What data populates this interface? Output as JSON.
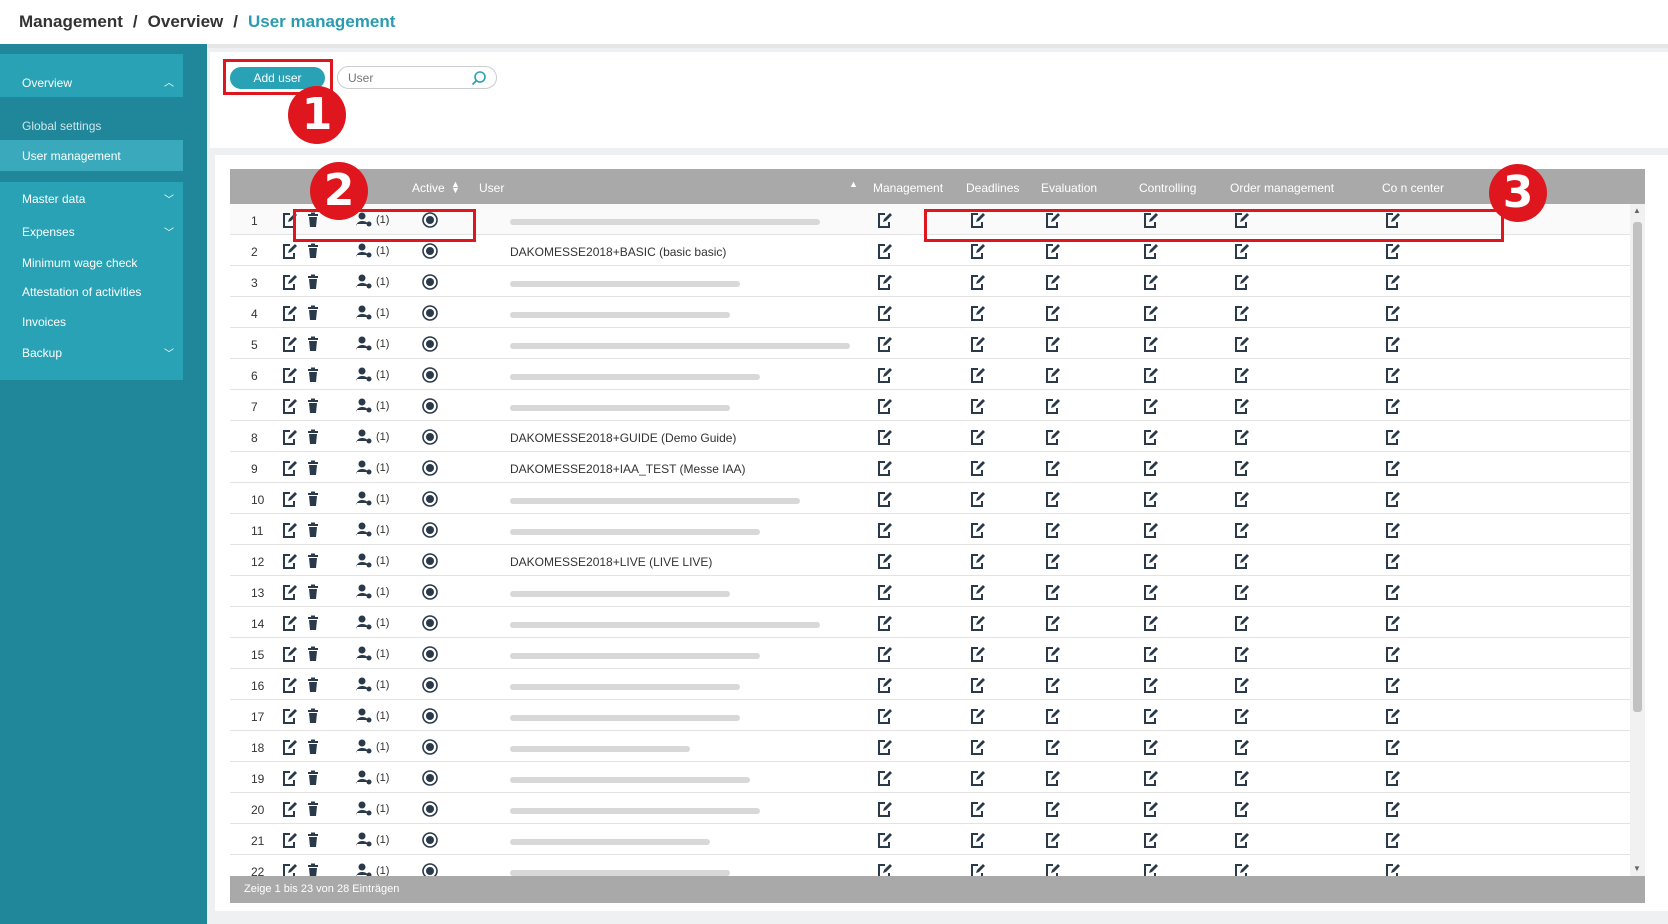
{
  "breadcrumb": {
    "part1": "Management",
    "part2": "Overview",
    "current": "User management",
    "separator": "/"
  },
  "sidebar": {
    "overview": "Overview",
    "global_settings": "Global settings",
    "user_management": "User management",
    "master_data": "Master data",
    "expenses": "Expenses",
    "minimum_wage": "Minimum wage check",
    "attestation": "Attestation of activities",
    "invoices": "Invoices",
    "backup": "Backup"
  },
  "toolbar": {
    "add_user": "Add user",
    "search_placeholder": "User"
  },
  "table": {
    "columns": {
      "active": "Active",
      "user": "User",
      "management": "Management",
      "deadlines": "Deadlines",
      "evaluation": "Evaluation",
      "controlling": "Controlling",
      "order_management": "Order management",
      "cost_center": "Co     n center"
    },
    "role_count": "(1)",
    "rows": [
      {
        "num": "1",
        "user": ""
      },
      {
        "num": "2",
        "user": "DAKOMESSE2018+BASIC (basic basic)"
      },
      {
        "num": "3",
        "user": ""
      },
      {
        "num": "4",
        "user": ""
      },
      {
        "num": "5",
        "user": ""
      },
      {
        "num": "6",
        "user": ""
      },
      {
        "num": "7",
        "user": ""
      },
      {
        "num": "8",
        "user": "DAKOMESSE2018+GUIDE (Demo Guide)"
      },
      {
        "num": "9",
        "user": "DAKOMESSE2018+IAA_TEST (Messe IAA)"
      },
      {
        "num": "10",
        "user": ""
      },
      {
        "num": "11",
        "user": ""
      },
      {
        "num": "12",
        "user": "DAKOMESSE2018+LIVE (LIVE LIVE)"
      },
      {
        "num": "13",
        "user": ""
      },
      {
        "num": "14",
        "user": ""
      },
      {
        "num": "15",
        "user": ""
      },
      {
        "num": "16",
        "user": ""
      },
      {
        "num": "17",
        "user": ""
      },
      {
        "num": "18",
        "user": ""
      },
      {
        "num": "19",
        "user": ""
      },
      {
        "num": "20",
        "user": ""
      },
      {
        "num": "21",
        "user": ""
      },
      {
        "num": "22",
        "user": ""
      }
    ],
    "footer": "Zeige 1 bis 23 von 28 Einträgen"
  },
  "annotations": {
    "badge1": "1",
    "badge2": "2",
    "badge3": "3"
  },
  "colors": {
    "accent": "#2aa2b6",
    "sidebar": "#20869a",
    "highlight": "#e0161e",
    "header_gray": "#a9a9a9"
  }
}
